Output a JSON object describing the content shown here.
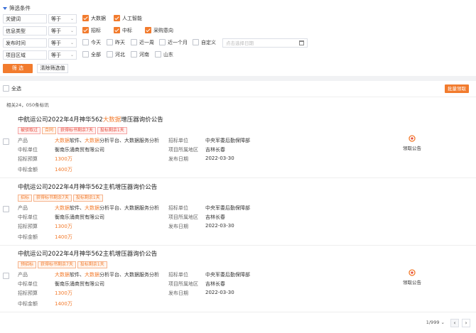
{
  "filter": {
    "title": "筛选条件",
    "rows": [
      {
        "field": "关键词",
        "op": "等于",
        "options": [
          {
            "label": "大数据",
            "checked": true
          },
          {
            "label": "人工智能",
            "checked": true
          }
        ]
      },
      {
        "field": "信息类型",
        "op": "等于",
        "options": [
          {
            "label": "招标",
            "checked": true
          },
          {
            "label": "中标",
            "checked": true
          },
          {
            "label": "采购意向",
            "checked": true
          }
        ]
      },
      {
        "field": "发布时间",
        "op": "等于",
        "options": [
          {
            "label": "今天",
            "checked": false
          },
          {
            "label": "昨天",
            "checked": false
          },
          {
            "label": "近一周",
            "checked": false
          },
          {
            "label": "近一个月",
            "checked": false
          },
          {
            "label": "自定义",
            "checked": false
          }
        ],
        "date_placeholder": "点击选择日期"
      },
      {
        "field": "项目区域",
        "op": "等于",
        "options": [
          {
            "label": "全部",
            "checked": false
          },
          {
            "label": "河北",
            "checked": false
          },
          {
            "label": "河南",
            "checked": false
          },
          {
            "label": "山东",
            "checked": false
          }
        ]
      }
    ],
    "submit_label": "筛 选",
    "clear_label": "清除筛选值"
  },
  "results": {
    "select_all_label": "全选",
    "batch_label": "批量领取",
    "count_text": "相关24，050条标讯",
    "items": [
      {
        "title_a": "中航运公司2022年4月神华562",
        "title_hl": "大数据",
        "title_b": "增压器询价公告",
        "tags": [
          {
            "text": "被驳取过",
            "color": "red"
          },
          {
            "text": "合同",
            "color": "orange"
          },
          {
            "text": "获得标书剩余7天",
            "color": "red"
          },
          {
            "text": "投标剩余1天",
            "color": "red"
          }
        ],
        "product_label": "产品",
        "product_hl1": "大数据",
        "product_a": "软件、",
        "product_hl2": "大数据",
        "product_b": "分析平台、大数据服务分析",
        "winner_label": "中标单位",
        "winner": "衡南乐涌商贸有限公司",
        "budget_label": "招标预算",
        "budget": "1300万",
        "amount_label": "中标金额",
        "amount": "1400万",
        "unit_label": "招标单位",
        "unit": "中央军委后勤保障部",
        "region_label": "项目所属地区",
        "region": "吉林长春",
        "date_label": "发布日期",
        "date": "2022-03-30",
        "claim_label": "领取公告"
      },
      {
        "title_a": "中航运公司2022年4月神华562主机增压器询价公告",
        "title_hl": "",
        "title_b": "",
        "tags": [
          {
            "text": "招标",
            "color": "orange"
          },
          {
            "text": "获得标书剩余7天",
            "color": "orange"
          },
          {
            "text": "投标剩余1天",
            "color": "orange"
          }
        ],
        "product_label": "产品",
        "product_hl1": "大数据",
        "product_a": "软件、",
        "product_hl2": "大数据",
        "product_b": "分析平台、大数据服务分析",
        "winner_label": "中标单位",
        "winner": "衡南乐涌商贸有限公司",
        "budget_label": "招标预算",
        "budget": "1300万",
        "amount_label": "中标金额",
        "amount": "1400万",
        "unit_label": "招标单位",
        "unit": "中央军委后勤保障部",
        "region_label": "项目所属地区",
        "region": "吉林长春",
        "date_label": "发布日期",
        "date": "2022-03-30",
        "claim_label": ""
      },
      {
        "title_a": "中航运公司2022年4月神华562主机增压器询价公告",
        "title_hl": "",
        "title_b": "",
        "tags": [
          {
            "text": "预招标",
            "color": "orange"
          },
          {
            "text": "获得标书剩余7天",
            "color": "orange"
          },
          {
            "text": "投标剩余1天",
            "color": "orange"
          }
        ],
        "product_label": "产品",
        "product_hl1": "大数据",
        "product_a": "软件、",
        "product_hl2": "大数据",
        "product_b": "分析平台、大数据服务分析",
        "winner_label": "中标单位",
        "winner": "衡南乐涌商贸有限公司",
        "budget_label": "招标预算",
        "budget": "1300万",
        "amount_label": "中标金额",
        "amount": "1400万",
        "unit_label": "招标单位",
        "unit": "中央军委后勤保障部",
        "region_label": "项目所属地区",
        "region": "吉林长春",
        "date_label": "发布日期",
        "date": "2022-03-30",
        "claim_label": "领取公告"
      }
    ],
    "pager": {
      "text": "1/999",
      "prev": "‹",
      "next": "›"
    }
  },
  "colors": {
    "accent": "#f27b2d",
    "tag_red": "#e64a3b",
    "panel_bg": "#f1f2f4"
  }
}
